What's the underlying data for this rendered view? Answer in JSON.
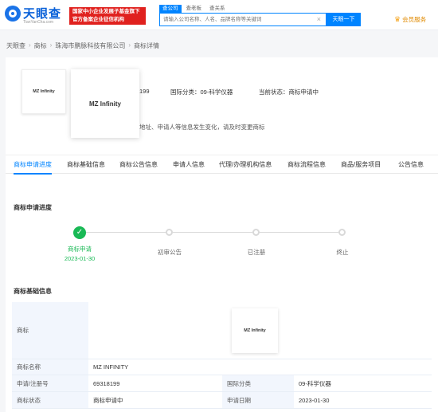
{
  "header": {
    "logo_text": "天眼查",
    "logo_sub": "TianYanCha.com",
    "ad_line1": "国家中小企业发展子基金旗下",
    "ad_line2": "官方备案企业征信机构",
    "search_tabs": [
      "查公司",
      "查老板",
      "查关系"
    ],
    "search_placeholder": "请输入公司名称、人名、品牌名称等关键词",
    "search_button": "天眼一下",
    "vip_label": "会员服务"
  },
  "breadcrumb": [
    "天眼查",
    "商标",
    "珠海市鹏脉科技有限公司",
    "商标详情"
  ],
  "summary": {
    "logo_small_text": "MZ Infinity",
    "logo_big_text": "MZ Infinity",
    "reg_no_partial": "199",
    "intl_class": "国际分类：09-科学仪器",
    "status": "当前状态：商标申请中",
    "notice": "地址、申请人等信息发生变化，请及时变更商标"
  },
  "tabs": [
    "商标申请进度",
    "商标基础信息",
    "商标公告信息",
    "申请人信息",
    "代理/办理机构信息",
    "商标流程信息",
    "商品/服务项目",
    "公告信息"
  ],
  "progress": {
    "title": "商标申请进度",
    "steps": [
      {
        "label": "商标申请",
        "date": "2023-01-30",
        "done": true
      },
      {
        "label": "初审公告",
        "date": "",
        "done": false
      },
      {
        "label": "已注册",
        "date": "",
        "done": false
      },
      {
        "label": "终止",
        "date": "",
        "done": false
      }
    ]
  },
  "basic_info": {
    "title": "商标基础信息",
    "trademark_key": "商标",
    "trademark_image_text": "MZ Infinity",
    "name_key": "商标名称",
    "name_value": "MZ INFINITY",
    "reg_no_key": "申请/注册号",
    "reg_no_value": "69318199",
    "class_key": "国际分类",
    "class_value": "09-科学仪器",
    "status_key": "商标状态",
    "status_value": "商标申请中",
    "date_key": "申请日期",
    "date_value": "2023-01-30"
  }
}
